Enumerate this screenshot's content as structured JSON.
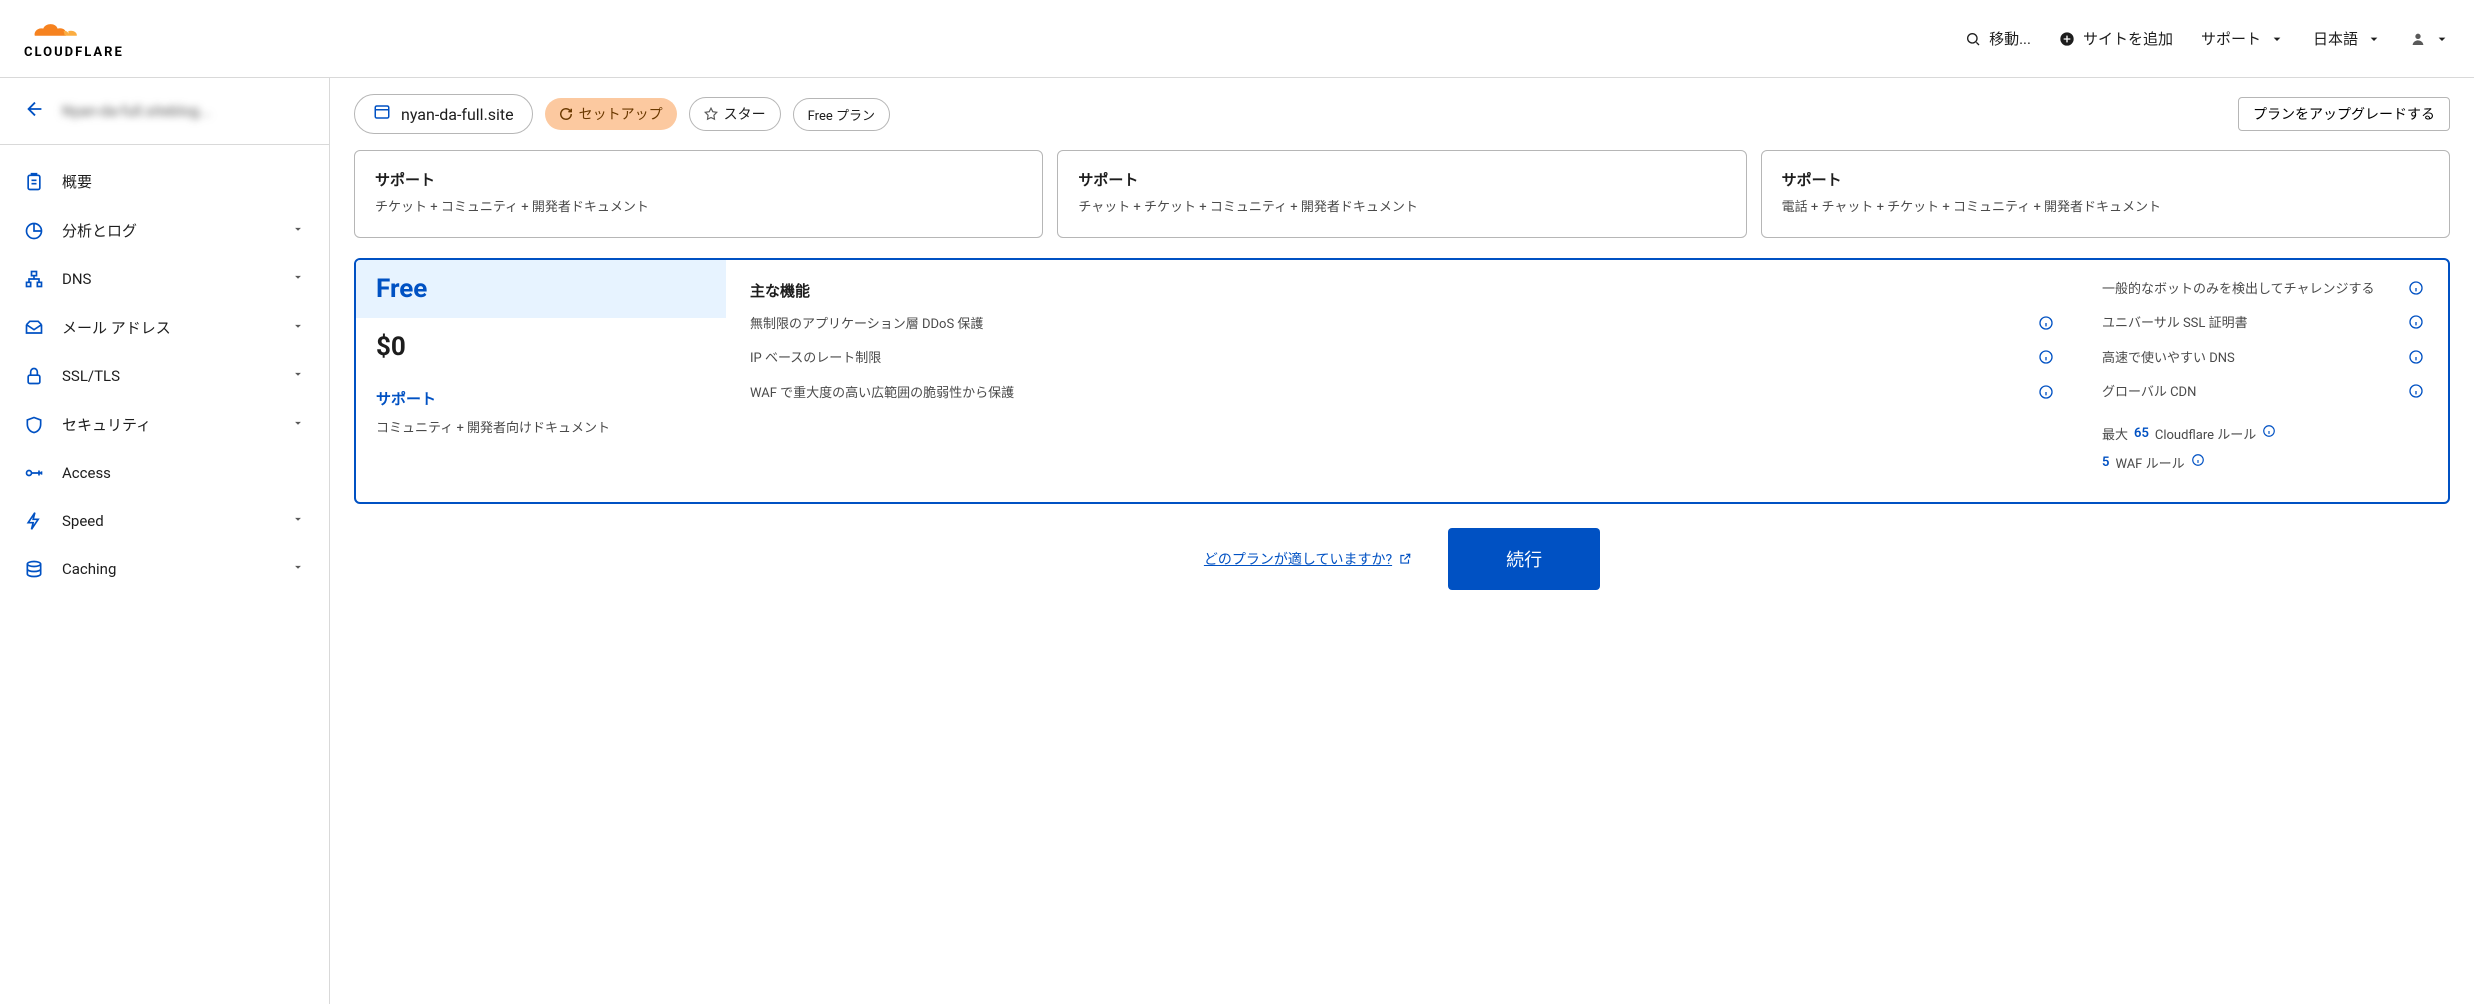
{
  "header": {
    "logo_text": "CLOUDFLARE",
    "go_to": "移動...",
    "add_site": "サイトを追加",
    "support": "サポート",
    "language": "日本語"
  },
  "sidebar": {
    "account_blur": "Nyan-da-full.siteblog...",
    "items": [
      {
        "label": "概要",
        "expandable": false
      },
      {
        "label": "分析とログ",
        "expandable": true
      },
      {
        "label": "DNS",
        "expandable": true
      },
      {
        "label": "メール アドレス",
        "expandable": true
      },
      {
        "label": "SSL/TLS",
        "expandable": true
      },
      {
        "label": "セキュリティ",
        "expandable": true
      },
      {
        "label": "Access",
        "expandable": false
      },
      {
        "label": "Speed",
        "expandable": true
      },
      {
        "label": "Caching",
        "expandable": true
      }
    ]
  },
  "page": {
    "site_name": "nyan-da-full.site",
    "setup_pill": "セットアップ",
    "star_pill": "スター",
    "free_pill": "Free プラン",
    "upgrade_btn": "プランをアップグレードする"
  },
  "top_cards": [
    {
      "support_label": "サポート",
      "support_text": "チケット + コミュニティ + 開発者ドキュメント"
    },
    {
      "support_label": "サポート",
      "support_text": "チャット + チケット + コミュニティ + 開発者ドキュメント"
    },
    {
      "support_label": "サポート",
      "support_text": "電話 + チャット + チケット + コミュニティ + 開発者ドキュメント"
    }
  ],
  "free_plan": {
    "title": "Free",
    "price": "$0",
    "support_label": "サポート",
    "support_text": "コミュニティ + 開発者向けドキュメント",
    "features_heading": "主な機能",
    "features_mid": [
      "無制限のアプリケーション層 DDoS 保護",
      "IP ベースのレート制限",
      "WAF で重大度の高い広範囲の脆弱性から保護"
    ],
    "features_right": [
      "一般的なボットのみを検出してチャレンジする",
      "ユニバーサル SSL 証明書",
      "高速で使いやすい DNS",
      "グローバル CDN"
    ],
    "rule1_prefix": "最大",
    "rule1_num": "65",
    "rule1_suffix": "Cloudflare ルール",
    "rule2_num": "5",
    "rule2_suffix": "WAF ルール"
  },
  "footer": {
    "which_plan": "どのプランが適していますか?",
    "continue": "続行"
  }
}
